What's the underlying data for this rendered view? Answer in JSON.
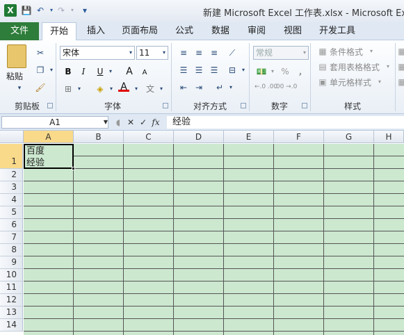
{
  "window": {
    "title": "新建 Microsoft Excel 工作表.xlsx - Microsoft Ex"
  },
  "tabs": [
    "文件",
    "开始",
    "插入",
    "页面布局",
    "公式",
    "数据",
    "审阅",
    "视图",
    "开发工具"
  ],
  "ribbon": {
    "clipboard": {
      "paste_label": "粘贴",
      "group": "剪贴板"
    },
    "font": {
      "name": "宋体",
      "size": "11",
      "group": "字体"
    },
    "alignment": {
      "group": "对齐方式"
    },
    "number": {
      "format": "常规",
      "group": "数字",
      "percent": "%",
      "comma": ",",
      "inc": "←.0 .00",
      "dec": ".00 →.0"
    },
    "styles": {
      "conditional": "条件格式",
      "table": "套用表格格式",
      "cell": "单元格样式",
      "group": "样式"
    }
  },
  "formula_bar": {
    "name_box": "A1",
    "fx": "fx",
    "content": "经验"
  },
  "columns": [
    "A",
    "B",
    "C",
    "D",
    "E",
    "F",
    "G",
    "H"
  ],
  "rows": [
    "1",
    "2",
    "3",
    "4",
    "5",
    "6",
    "7",
    "8",
    "9",
    "10",
    "11",
    "12",
    "13",
    "14"
  ],
  "cells": {
    "A1": "百度\n经验"
  },
  "colors": {
    "sheet_bg": "#cce8cf",
    "file_tab": "#2e7d3a",
    "selection_header": "#f9d98a"
  }
}
